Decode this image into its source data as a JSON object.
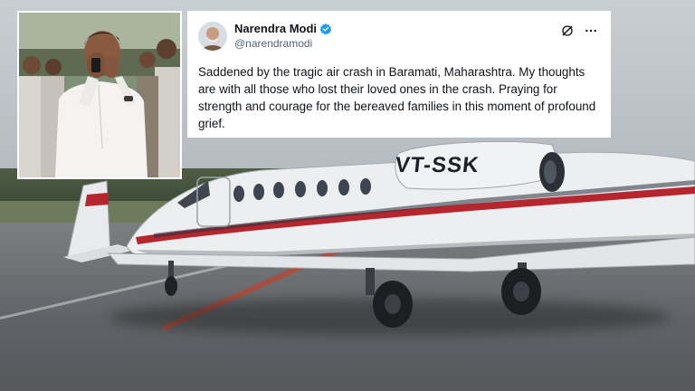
{
  "post": {
    "author_name": "Narendra Modi",
    "author_handle": "@narendramodi",
    "verified": true,
    "text": "Saddened by the tragic air crash in Baramati, Maharashtra. My thoughts are with all those who lost their loved ones in the crash. Praying for strength and courage for the bereaved families in this moment of profound grief."
  },
  "header_icons": [
    "grok-icon",
    "more-options-icon"
  ],
  "aircraft": {
    "registration": "VT-SSK"
  },
  "colors": {
    "verified_badge": "#1d9bf0",
    "text_primary": "#0f1419",
    "text_secondary": "#536471",
    "card_bg": "#ffffff",
    "jet_stripe": "#b5262f"
  }
}
